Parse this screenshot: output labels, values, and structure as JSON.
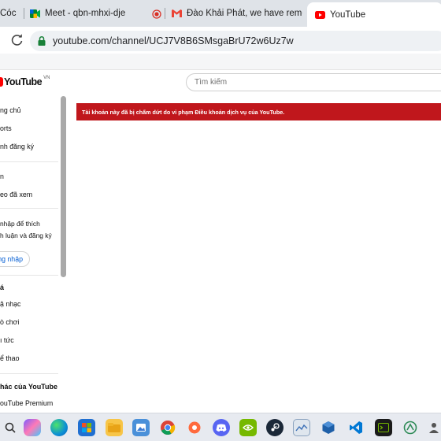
{
  "browser": {
    "tabs": [
      {
        "title": "Cóc",
        "icon": "coc-icon"
      },
      {
        "title": "Meet - qbn-mhxi-dje",
        "icon": "meet-icon"
      },
      {
        "title": "Đào Khải Phát, we have removec",
        "icon": "gmail-icon"
      },
      {
        "title": "YouTube",
        "icon": "youtube-icon",
        "active": true
      }
    ],
    "url": "youtube.com/channel/UCJ7V8B6SMsgaBrU72w6Uz7w"
  },
  "youtube": {
    "logo_text": "YouTube",
    "country_code": "VN",
    "search_placeholder": "Tìm kiếm",
    "alert_text": "Tài khoản này đã bị chấm dứt do vi phạm Điều khoản dịch vụ của YouTube.",
    "alert_color": "#c0171c"
  },
  "sidebar": {
    "home": "ng chủ",
    "shorts": "orts",
    "subscriptions": "nh đăng ký",
    "you": "n",
    "history": "eo đã xem",
    "login_prompt": "nhập để thích\nh luận và đăng ký",
    "login_button": "ng nhập",
    "explore_heading": "á",
    "music": "ậ nhạc",
    "gaming": "ò chơi",
    "news": "ı tức",
    "sports": "ể thao",
    "more_heading": "hác của YouTube",
    "premium": "ouTube Premium"
  },
  "taskbar": {
    "icons": [
      "copilot-icon",
      "edge-icon",
      "store-icon",
      "file-explorer-icon",
      "photos-icon",
      "chrome-icon",
      "screenshot-icon",
      "discord-icon",
      "nvidia-icon",
      "steam-icon",
      "monitor-icon",
      "virtualbox-icon",
      "vscode-icon",
      "terminal-icon",
      "app-icon",
      "person-icon"
    ]
  }
}
